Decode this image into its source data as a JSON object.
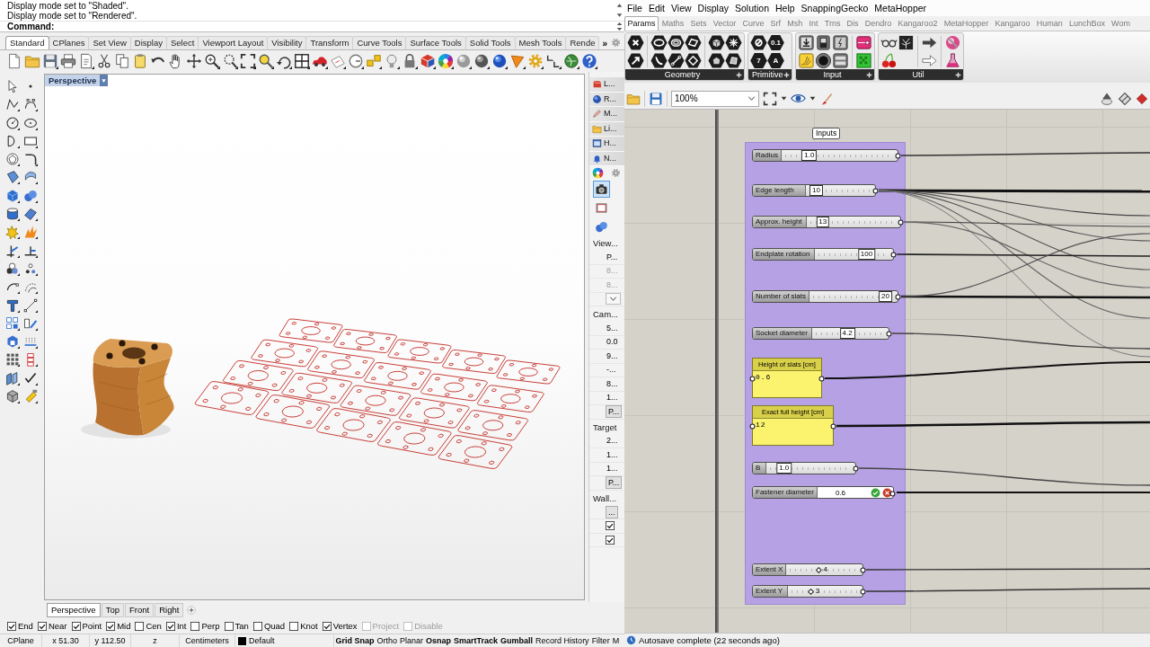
{
  "rhino": {
    "command_history": [
      "Display mode set to \"Shaded\".",
      "Display mode set to \"Rendered\"."
    ],
    "command_prompt": "Command:",
    "toolbar_tabs": [
      {
        "label": "Standard",
        "selected": true
      },
      {
        "label": "CPlanes",
        "selected": false
      },
      {
        "label": "Set View",
        "selected": false
      },
      {
        "label": "Display",
        "selected": false
      },
      {
        "label": "Select",
        "selected": false
      },
      {
        "label": "Viewport Layout",
        "selected": false
      },
      {
        "label": "Visibility",
        "selected": false
      },
      {
        "label": "Transform",
        "selected": false
      },
      {
        "label": "Curve Tools",
        "selected": false
      },
      {
        "label": "Surface Tools",
        "selected": false
      },
      {
        "label": "Solid Tools",
        "selected": false
      },
      {
        "label": "Mesh Tools",
        "selected": false
      },
      {
        "label": "Rende",
        "selected": false
      }
    ],
    "toolbar_overflow": "»",
    "viewport": {
      "title": "Perspective"
    },
    "panel_tabs": [
      {
        "label": "L..."
      },
      {
        "label": "R..."
      },
      {
        "label": "M..."
      },
      {
        "label": "Li..."
      },
      {
        "label": "H..."
      },
      {
        "label": "N..."
      }
    ],
    "panel_pages": [
      {
        "selected": true
      },
      {
        "selected": false
      },
      {
        "selected": false
      }
    ],
    "properties": [
      {
        "title": "View...",
        "rows": [
          {
            "kind": "value",
            "text": "P...",
            "disabled": false
          },
          {
            "kind": "value",
            "text": "8...",
            "disabled": true
          },
          {
            "kind": "value",
            "text": "8...",
            "disabled": true
          },
          {
            "kind": "dropdown"
          }
        ]
      },
      {
        "title": "Cam...",
        "rows": [
          {
            "kind": "value",
            "text": "5...",
            "disabled": false
          },
          {
            "kind": "value",
            "text": "0.0",
            "disabled": false
          },
          {
            "kind": "value",
            "text": "9...",
            "disabled": false
          },
          {
            "kind": "value",
            "text": "-...",
            "disabled": false
          },
          {
            "kind": "value",
            "text": "8...",
            "disabled": false
          },
          {
            "kind": "value",
            "text": "1...",
            "disabled": false
          },
          {
            "kind": "button",
            "text": "P..."
          }
        ]
      },
      {
        "title": "Target",
        "rows": [
          {
            "kind": "value",
            "text": "2...",
            "disabled": false
          },
          {
            "kind": "value",
            "text": "1...",
            "disabled": false
          },
          {
            "kind": "value",
            "text": "1...",
            "disabled": false
          },
          {
            "kind": "button",
            "text": "P..."
          }
        ]
      },
      {
        "title": "Wall...",
        "rows": [
          {
            "kind": "button",
            "text": "..."
          },
          {
            "kind": "checkbox",
            "checked": true
          },
          {
            "kind": "checkbox",
            "checked": true
          }
        ]
      }
    ],
    "viewport_tabs": [
      {
        "label": "Perspective",
        "selected": true
      },
      {
        "label": "Top",
        "selected": false
      },
      {
        "label": "Front",
        "selected": false
      },
      {
        "label": "Right",
        "selected": false
      }
    ],
    "osnaps": [
      {
        "label": "End",
        "checked": true,
        "disabled": false
      },
      {
        "label": "Near",
        "checked": true,
        "disabled": false
      },
      {
        "label": "Point",
        "checked": true,
        "disabled": false
      },
      {
        "label": "Mid",
        "checked": true,
        "disabled": false
      },
      {
        "label": "Cen",
        "checked": false,
        "disabled": false
      },
      {
        "label": "Int",
        "checked": true,
        "disabled": false
      },
      {
        "label": "Perp",
        "checked": false,
        "disabled": false
      },
      {
        "label": "Tan",
        "checked": false,
        "disabled": false
      },
      {
        "label": "Quad",
        "checked": false,
        "disabled": false
      },
      {
        "label": "Knot",
        "checked": false,
        "disabled": false
      },
      {
        "label": "Vertex",
        "checked": true,
        "disabled": false
      },
      {
        "label": "Project",
        "checked": false,
        "disabled": true
      },
      {
        "label": "Disable",
        "checked": false,
        "disabled": true
      }
    ],
    "status_bar": [
      {
        "kind": "cell",
        "text": "CPlane"
      },
      {
        "kind": "cell",
        "text": "x 51.30"
      },
      {
        "kind": "cell",
        "text": "y 112.50"
      },
      {
        "kind": "cell",
        "text": "z"
      },
      {
        "kind": "cell",
        "text": "Centimeters"
      },
      {
        "kind": "layer",
        "text": "Default",
        "color": "#000000"
      },
      {
        "kind": "toggle",
        "text": "Grid Snap",
        "on": true
      },
      {
        "kind": "toggle",
        "text": "Ortho",
        "on": false
      },
      {
        "kind": "toggle",
        "text": "Planar",
        "on": false
      },
      {
        "kind": "toggle",
        "text": "Osnap",
        "on": true
      },
      {
        "kind": "toggle",
        "text": "SmartTrack",
        "on": true
      },
      {
        "kind": "toggle",
        "text": "Gumball",
        "on": true
      },
      {
        "kind": "toggle",
        "text": "Record History",
        "on": false
      },
      {
        "kind": "toggle",
        "text": "Filter",
        "on": false
      },
      {
        "kind": "toggle",
        "text": "M",
        "on": false
      }
    ]
  },
  "grasshopper": {
    "menu": [
      "File",
      "Edit",
      "View",
      "Display",
      "Solution",
      "Help",
      "SnappingGecko",
      "MetaHopper"
    ],
    "tabs": [
      {
        "label": "Params",
        "selected": true
      },
      {
        "label": "Maths",
        "selected": false
      },
      {
        "label": "Sets",
        "selected": false
      },
      {
        "label": "Vector",
        "selected": false
      },
      {
        "label": "Curve",
        "selected": false
      },
      {
        "label": "Srf",
        "selected": false
      },
      {
        "label": "Msh",
        "selected": false
      },
      {
        "label": "Int",
        "selected": false
      },
      {
        "label": "Trns",
        "selected": false
      },
      {
        "label": "Dis",
        "selected": false
      },
      {
        "label": "Dendro",
        "selected": false
      },
      {
        "label": "Kangaroo2",
        "selected": false
      },
      {
        "label": "MetaHopper",
        "selected": false
      },
      {
        "label": "Kangaroo",
        "selected": false
      },
      {
        "label": "Human",
        "selected": false
      },
      {
        "label": "LunchBox",
        "selected": false
      },
      {
        "label": "Wom",
        "selected": false
      }
    ],
    "ribbon_groups": [
      {
        "label": "Geometry"
      },
      {
        "label": "Primitive",
        "glyphs": [
          "0.1",
          "7",
          "A"
        ]
      },
      {
        "label": "Input"
      },
      {
        "label": "Util"
      }
    ],
    "zoom": "100%",
    "group": {
      "label": "Inputs"
    },
    "components": [
      {
        "kind": "slider",
        "name": "Radius",
        "value": "1.0",
        "level": 0.18
      },
      {
        "kind": "slider",
        "name": "Edge length",
        "value": "10",
        "level": 0
      },
      {
        "kind": "slider",
        "name": "Approx. height",
        "value": "13",
        "level": 0.08
      },
      {
        "kind": "slider",
        "name": "Endplate rotation",
        "value": "100",
        "level": 0.76
      },
      {
        "kind": "slider",
        "name": "Number of slats",
        "value": "20",
        "level": 1
      },
      {
        "kind": "slider",
        "name": "Socket diameter",
        "value": "4.2",
        "level": 0.46
      },
      {
        "kind": "panel",
        "name": "Height of slats [cm]",
        "value": "0.6"
      },
      {
        "kind": "panel",
        "name": "Exact full height [cm]",
        "value": "12"
      },
      {
        "kind": "slider",
        "name": "B",
        "value": "1.0",
        "level": 0.1
      },
      {
        "kind": "editor",
        "name": "Fastener diameter",
        "value": "0.6"
      },
      {
        "kind": "diamond",
        "name": "Extent X",
        "value": "4",
        "level": 0.46
      },
      {
        "kind": "diamond",
        "name": "Extent Y",
        "value": "3",
        "level": 0.3
      }
    ],
    "status": "Autosave complete (22 seconds ago)"
  }
}
